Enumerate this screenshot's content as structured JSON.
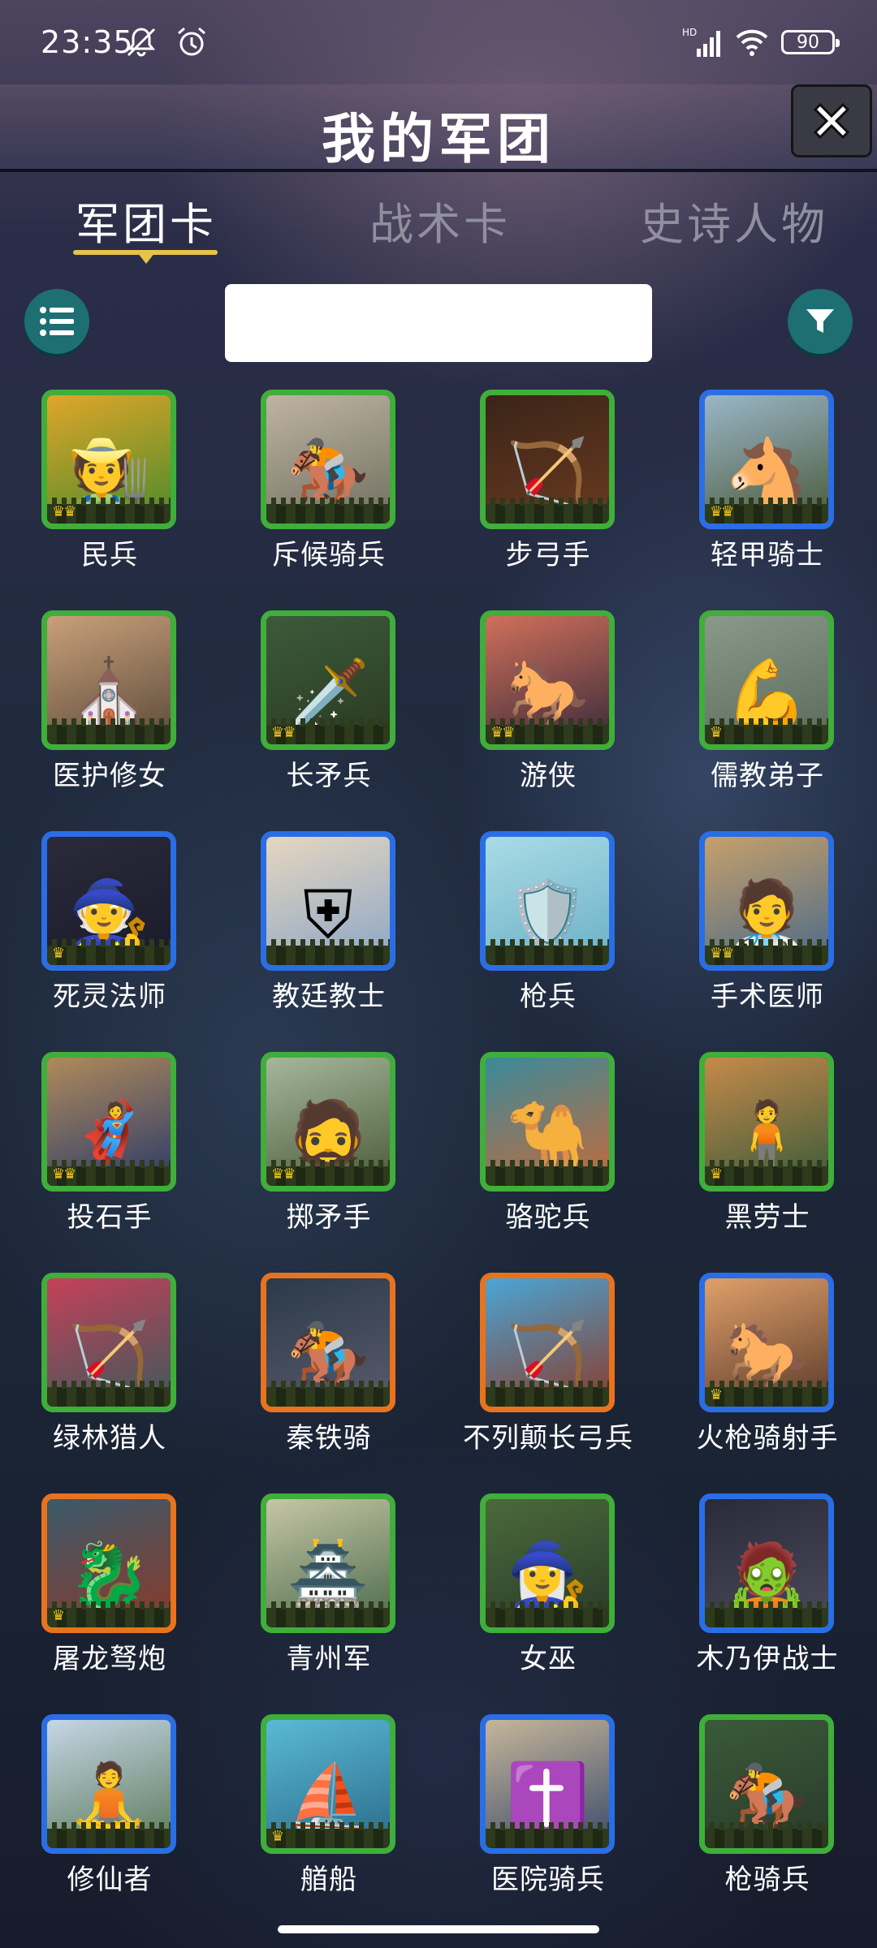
{
  "status_bar": {
    "time": "23:35",
    "battery": "90"
  },
  "header": {
    "title": "我的军团"
  },
  "tabs": [
    {
      "label": "军团卡",
      "active": true
    },
    {
      "label": "战术卡",
      "active": false
    },
    {
      "label": "史诗人物",
      "active": false
    }
  ],
  "search": {
    "value": "",
    "placeholder": ""
  },
  "cards": [
    {
      "name": "民兵",
      "rarity": "green",
      "crowns": 2,
      "icon": "🧑‍🌾",
      "bg": [
        "#e0a62a",
        "#4a8a2a"
      ]
    },
    {
      "name": "斥候骑兵",
      "rarity": "green",
      "crowns": 0,
      "icon": "🏇",
      "bg": [
        "#bfb4a4",
        "#6f6f5f"
      ]
    },
    {
      "name": "步弓手",
      "rarity": "green",
      "crowns": 0,
      "icon": "🏹",
      "bg": [
        "#3a2418",
        "#6a3a20"
      ]
    },
    {
      "name": "轻甲骑士",
      "rarity": "blue",
      "crowns": 2,
      "icon": "🐴",
      "bg": [
        "#9ab6c8",
        "#4a5a3a"
      ]
    },
    {
      "name": "医护修女",
      "rarity": "green",
      "crowns": 0,
      "icon": "⛪",
      "bg": [
        "#c9a07a",
        "#5a4a3a"
      ]
    },
    {
      "name": "长矛兵",
      "rarity": "green",
      "crowns": 2,
      "icon": "🗡️",
      "bg": [
        "#3c5a3a",
        "#2a3a22"
      ]
    },
    {
      "name": "游侠",
      "rarity": "green",
      "crowns": 2,
      "icon": "🐎",
      "bg": [
        "#d0705a",
        "#3a2a3a"
      ]
    },
    {
      "name": "儒教弟子",
      "rarity": "green",
      "crowns": 1,
      "icon": "💪",
      "bg": [
        "#8a9a8a",
        "#5a6a5a"
      ]
    },
    {
      "name": "死灵法师",
      "rarity": "blue",
      "crowns": 1,
      "icon": "🧙",
      "bg": [
        "#2a2a3a",
        "#1a1a2a"
      ]
    },
    {
      "name": "教廷教士",
      "rarity": "blue",
      "crowns": 0,
      "icon": "⛨",
      "bg": [
        "#e6d6c0",
        "#8aa6c6"
      ]
    },
    {
      "name": "枪兵",
      "rarity": "blue",
      "crowns": 0,
      "icon": "🛡️",
      "bg": [
        "#aadbe6",
        "#6ab0c6"
      ]
    },
    {
      "name": "手术医师",
      "rarity": "blue",
      "crowns": 2,
      "icon": "🧑‍⚕️",
      "bg": [
        "#c6a06a",
        "#4a6a8a"
      ]
    },
    {
      "name": "投石手",
      "rarity": "green",
      "crowns": 2,
      "icon": "🦸",
      "bg": [
        "#b08a5a",
        "#2a3a6a"
      ]
    },
    {
      "name": "掷矛手",
      "rarity": "green",
      "crowns": 2,
      "icon": "🧔",
      "bg": [
        "#a6b89a",
        "#4a5a3a"
      ]
    },
    {
      "name": "骆驼兵",
      "rarity": "green",
      "crowns": 0,
      "icon": "🐪",
      "bg": [
        "#3a8a9a",
        "#c66a3a"
      ]
    },
    {
      "name": "黑劳士",
      "rarity": "green",
      "crowns": 1,
      "icon": "🧍",
      "bg": [
        "#c68a4a",
        "#3a5a3a"
      ]
    },
    {
      "name": "绿林猎人",
      "rarity": "green",
      "crowns": 0,
      "icon": "🏹",
      "bg": [
        "#c6405a",
        "#3a5a5a"
      ]
    },
    {
      "name": "秦铁骑",
      "rarity": "orange",
      "crowns": 0,
      "icon": "🏇",
      "bg": [
        "#2a3a4a",
        "#5a5a6a"
      ]
    },
    {
      "name": "不列颠长弓兵",
      "rarity": "orange",
      "crowns": 0,
      "icon": "🏹",
      "bg": [
        "#4aa6d6",
        "#8a3a2a"
      ]
    },
    {
      "name": "火枪骑射手",
      "rarity": "blue",
      "crowns": 1,
      "icon": "🐎",
      "bg": [
        "#e0a06a",
        "#5a3a2a"
      ]
    },
    {
      "name": "屠龙驽炮",
      "rarity": "orange",
      "crowns": 1,
      "icon": "🐉",
      "bg": [
        "#3a5a6a",
        "#8a3a2a"
      ]
    },
    {
      "name": "青州军",
      "rarity": "green",
      "crowns": 0,
      "icon": "🏯",
      "bg": [
        "#c6c6a6",
        "#4a6a4a"
      ]
    },
    {
      "name": "女巫",
      "rarity": "green",
      "crowns": 0,
      "icon": "🧙‍♀️",
      "bg": [
        "#4a6a3a",
        "#2a3a2a"
      ]
    },
    {
      "name": "木乃伊战士",
      "rarity": "blue",
      "crowns": 0,
      "icon": "🧟",
      "bg": [
        "#2a2a3a",
        "#4a4a5a"
      ]
    },
    {
      "name": "修仙者",
      "rarity": "blue",
      "crowns": 0,
      "icon": "🧘",
      "bg": [
        "#c6d6e6",
        "#5a7a5a"
      ]
    },
    {
      "name": "艏船",
      "rarity": "green",
      "crowns": 1,
      "icon": "⛵",
      "bg": [
        "#5abad6",
        "#2a6a8a"
      ]
    },
    {
      "name": "医院骑兵",
      "rarity": "blue",
      "crowns": 0,
      "icon": "✝️",
      "bg": [
        "#c6b69a",
        "#3a4a6a"
      ]
    },
    {
      "name": "枪骑兵",
      "rarity": "green",
      "crowns": 0,
      "icon": "🏇",
      "bg": [
        "#3a5a3a",
        "#2a3a2a"
      ]
    }
  ]
}
